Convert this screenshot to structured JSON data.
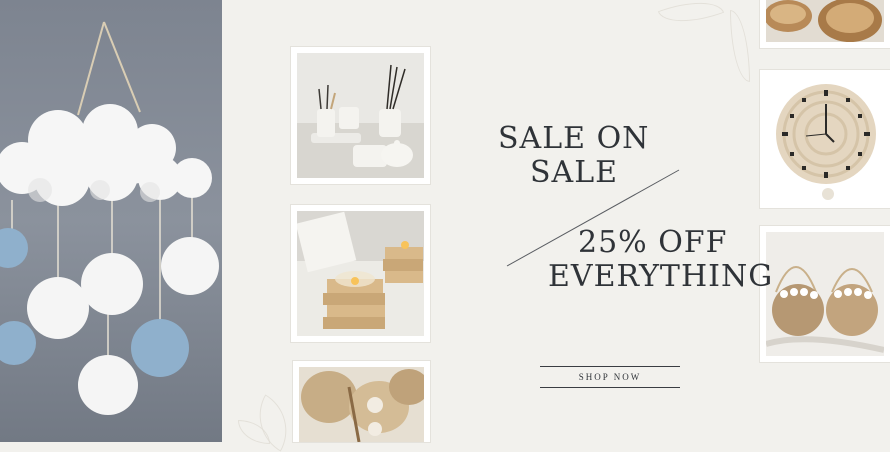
{
  "banner": {
    "title_line1": "SALE ON",
    "title_line2": "SALE",
    "offer_line1": "25% OFF",
    "offer_line2": "EVERYTHING",
    "cta_label": "SHOP NOW"
  },
  "colors": {
    "background": "#f2f1ed",
    "text": "#2f3338",
    "pompom_white": "#f7f7f7",
    "pompom_blue": "#8fb0cc"
  },
  "images": [
    {
      "name": "pompom-cloud-wall-hanging"
    },
    {
      "name": "ceramic-diffuser-set"
    },
    {
      "name": "wooden-candle-holders"
    },
    {
      "name": "woven-fan-decor"
    },
    {
      "name": "rattan-trays"
    },
    {
      "name": "rope-wall-clock"
    },
    {
      "name": "woven-daisy-bags"
    }
  ]
}
